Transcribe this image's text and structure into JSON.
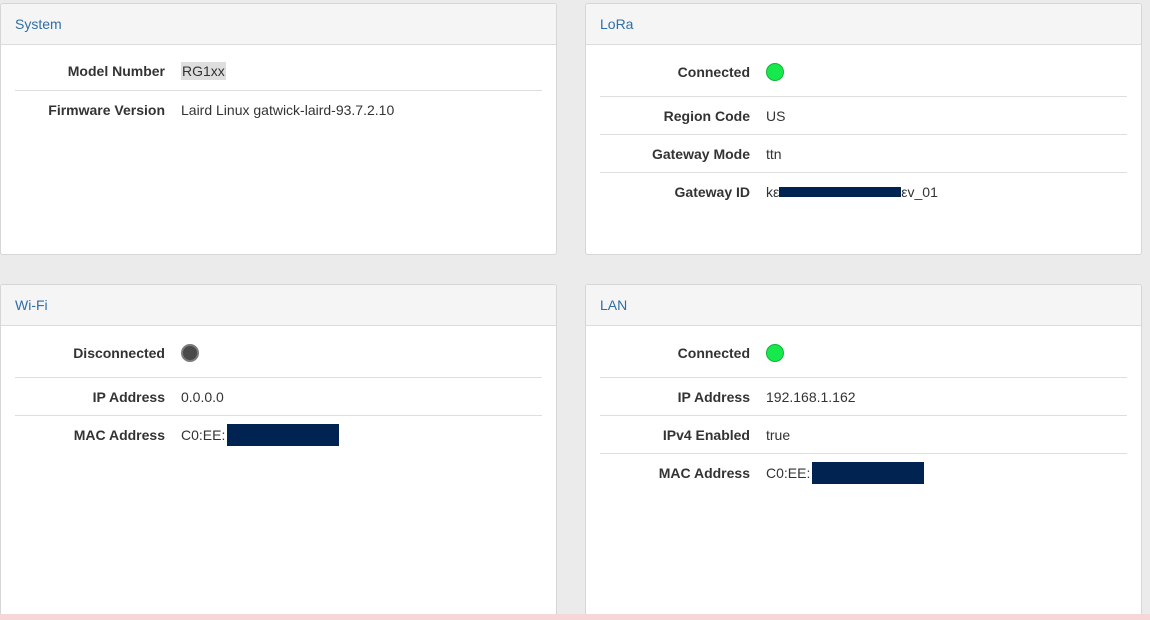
{
  "colors": {
    "background": "#ebebeb",
    "heading_text": "#2f6fa6",
    "led_connected": "#17e84b",
    "led_disconnected": "#4a4a4a",
    "redaction": "#002352"
  },
  "system": {
    "title": "System",
    "rows": [
      {
        "label": "Model Number",
        "value": "RG1xx"
      },
      {
        "label": "Firmware Version",
        "value": "Laird Linux gatwick-laird-93.7.2.10"
      }
    ]
  },
  "lora": {
    "title": "LoRa",
    "status_label": "Connected",
    "status_icon": "green-led-icon",
    "rows": [
      {
        "label": "Region Code",
        "value": "US"
      },
      {
        "label": "Gateway Mode",
        "value": "ttn"
      },
      {
        "label": "Gateway ID",
        "value_prefix": "kε",
        "value_suffix": "εv_01"
      }
    ]
  },
  "wifi": {
    "title": "Wi-Fi",
    "status_label": "Disconnected",
    "status_icon": "gray-led-icon",
    "rows": [
      {
        "label": "IP Address",
        "value": "0.0.0.0"
      },
      {
        "label": "MAC Address",
        "value_prefix": "C0:EE:"
      }
    ]
  },
  "lan": {
    "title": "LAN",
    "status_label": "Connected",
    "status_icon": "green-led-icon",
    "rows": [
      {
        "label": "IP Address",
        "value": "192.168.1.162"
      },
      {
        "label": "IPv4 Enabled",
        "value": "true"
      },
      {
        "label": "MAC Address",
        "value_prefix": "C0:EE:"
      }
    ]
  }
}
